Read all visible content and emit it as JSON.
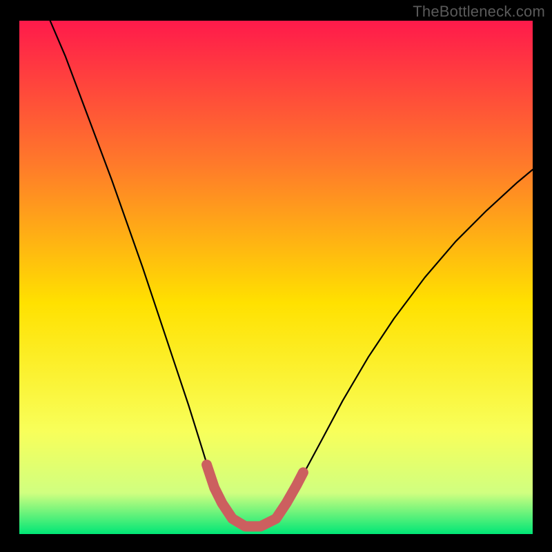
{
  "watermark": "TheBottleneck.com",
  "chart_data": {
    "type": "line",
    "title": "",
    "xlabel": "",
    "ylabel": "",
    "xlim": [
      0,
      1
    ],
    "ylim": [
      0,
      1
    ],
    "gradient_colors": {
      "top": "#ff1a4b",
      "upper_mid": "#ff7a2a",
      "mid": "#ffe100",
      "lower_mid": "#f8ff5a",
      "near_bottom": "#d0ff80",
      "bottom": "#00e676"
    },
    "series": [
      {
        "name": "bottleneck-curve",
        "stroke": "#000000",
        "points": [
          {
            "x": 0.06,
            "y": 1.0
          },
          {
            "x": 0.09,
            "y": 0.93
          },
          {
            "x": 0.12,
            "y": 0.85
          },
          {
            "x": 0.15,
            "y": 0.77
          },
          {
            "x": 0.18,
            "y": 0.69
          },
          {
            "x": 0.21,
            "y": 0.605
          },
          {
            "x": 0.24,
            "y": 0.52
          },
          {
            "x": 0.27,
            "y": 0.43
          },
          {
            "x": 0.3,
            "y": 0.34
          },
          {
            "x": 0.33,
            "y": 0.25
          },
          {
            "x": 0.355,
            "y": 0.17
          },
          {
            "x": 0.375,
            "y": 0.105
          },
          {
            "x": 0.395,
            "y": 0.06
          },
          {
            "x": 0.415,
            "y": 0.03
          },
          {
            "x": 0.44,
            "y": 0.015
          },
          {
            "x": 0.47,
            "y": 0.015
          },
          {
            "x": 0.5,
            "y": 0.03
          },
          {
            "x": 0.525,
            "y": 0.065
          },
          {
            "x": 0.555,
            "y": 0.12
          },
          {
            "x": 0.59,
            "y": 0.185
          },
          {
            "x": 0.63,
            "y": 0.26
          },
          {
            "x": 0.68,
            "y": 0.345
          },
          {
            "x": 0.73,
            "y": 0.42
          },
          {
            "x": 0.79,
            "y": 0.5
          },
          {
            "x": 0.85,
            "y": 0.57
          },
          {
            "x": 0.91,
            "y": 0.63
          },
          {
            "x": 0.97,
            "y": 0.685
          },
          {
            "x": 1.0,
            "y": 0.71
          }
        ]
      },
      {
        "name": "optimal-zone-highlight",
        "stroke": "#cc5f5f",
        "thick": true,
        "points": [
          {
            "x": 0.365,
            "y": 0.135
          },
          {
            "x": 0.38,
            "y": 0.09
          },
          {
            "x": 0.395,
            "y": 0.06
          },
          {
            "x": 0.415,
            "y": 0.03
          },
          {
            "x": 0.44,
            "y": 0.015
          },
          {
            "x": 0.47,
            "y": 0.015
          },
          {
            "x": 0.5,
            "y": 0.03
          },
          {
            "x": 0.52,
            "y": 0.06
          },
          {
            "x": 0.54,
            "y": 0.095
          },
          {
            "x": 0.553,
            "y": 0.12
          }
        ]
      }
    ]
  }
}
